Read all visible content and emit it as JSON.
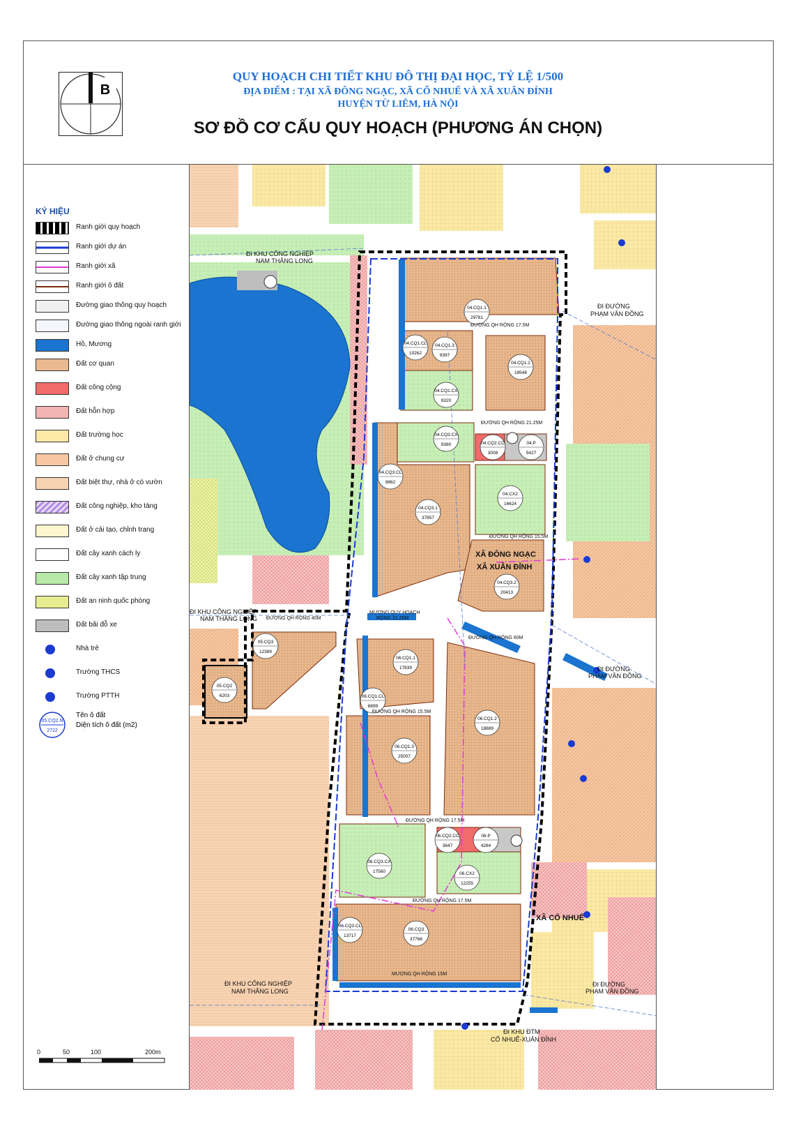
{
  "header": {
    "logo_letter": "B",
    "line1": "QUY HOẠCH CHI TIẾT KHU ĐÔ THỊ ĐẠI HỌC, TỶ LỆ 1/500",
    "line2": "ĐỊA ĐIỂM : TẠI XÃ ĐÔNG NGẠC, XÃ CỔ NHUẾ VÀ XÃ XUÂN ĐỈNH",
    "line3": "HUYỆN TỪ LIÊM, HÀ NỘI",
    "main_title": "SƠ ĐỒ CƠ CẤU QUY HOẠCH (PHƯƠNG ÁN CHỌN)"
  },
  "legend": {
    "title": "KÝ HIỆU",
    "items": [
      {
        "label": "Ranh giới quy hoạch",
        "swatch": "boundary-plan"
      },
      {
        "label": "Ranh giới dự án",
        "swatch": "boundary-project"
      },
      {
        "label": "Ranh giới xã",
        "swatch": "boundary-commune"
      },
      {
        "label": "Ranh giới ô đất",
        "swatch": "boundary-lot"
      },
      {
        "label": "Đường giao thông quy hoạch",
        "swatch": "road-plan"
      },
      {
        "label": "Đường giao thông ngoài ranh giới",
        "swatch": "road-outside"
      },
      {
        "label": "Hồ, Mương",
        "swatch": "water"
      },
      {
        "label": "Đất cơ quan",
        "swatch": "office"
      },
      {
        "label": "Đất công cộng",
        "swatch": "public"
      },
      {
        "label": "Đất hỗn hợp",
        "swatch": "mixed"
      },
      {
        "label": "Đất trường học",
        "swatch": "school"
      },
      {
        "label": "Đất ở chung cư",
        "swatch": "apartment"
      },
      {
        "label": "Đất biệt thự, nhà ở có vườn",
        "swatch": "villa"
      },
      {
        "label": "Đất công nghiệp, kho tàng",
        "swatch": "industry"
      },
      {
        "label": "Đất ở cải tạo, chỉnh trang",
        "swatch": "renovation"
      },
      {
        "label": "Đất cây xanh cách ly",
        "swatch": "green-buffer"
      },
      {
        "label": "Đất cây xanh tập trung",
        "swatch": "green"
      },
      {
        "label": "Đất an ninh quốc phòng",
        "swatch": "defense"
      },
      {
        "label": "Đất bãi đỗ xe",
        "swatch": "parking"
      },
      {
        "label": "Nhà trẻ",
        "swatch": "kindergarten"
      },
      {
        "label": "Trường THCS",
        "swatch": "middle-school"
      },
      {
        "label": "Trường PTTH",
        "swatch": "high-school"
      }
    ],
    "sample_lot": {
      "name": "05.CQ2.N",
      "area": "2722"
    },
    "sample_name_label": "Tên ô đất",
    "sample_area_label": "Diện tích ô đất (m2)"
  },
  "colors": {
    "office": "#e9b98f",
    "public": "#f26b6b",
    "mixed": "#f3b4b4",
    "school": "#fbe9a6",
    "apartment": "#f6c7a2",
    "villa": "#f7d3b3",
    "green": "#b9e9a8",
    "water": "#1a74d0",
    "parking": "#bdbdbd",
    "road": "#ffffff",
    "defense": "#e6ec8f",
    "industry": "#b48ee0",
    "renovation": "#fdf6cf",
    "boundary_project": "#1a3ad1",
    "boundary_commune": "#e03ad4"
  },
  "lots": [
    {
      "name": "04.CQ1.1",
      "area": "29781"
    },
    {
      "name": "04.CQ1.CL",
      "area": "10262"
    },
    {
      "name": "04.CQ1.3",
      "area": "9397"
    },
    {
      "name": "04.CQ1.2",
      "area": "18548"
    },
    {
      "name": "04.CQ1.CX",
      "area": "9320"
    },
    {
      "name": "04.CQ3.CX",
      "area": "9380"
    },
    {
      "name": "04.CQ2.CC",
      "area": "3008"
    },
    {
      "name": "04.P",
      "area": "5427"
    },
    {
      "name": "04.CQ3.CL",
      "area": "9862"
    },
    {
      "name": "04.CX2",
      "area": "16624"
    },
    {
      "name": "04.CQ3.1",
      "area": "37857"
    },
    {
      "name": "04.CQ3.2",
      "area": "20413"
    },
    {
      "name": "05.CQ3",
      "area": "12389"
    },
    {
      "name": "06.CQ1.1",
      "area": "17839"
    },
    {
      "name": "05.CQ2",
      "area": "6203"
    },
    {
      "name": "06.CQ1.CL",
      "area": "8899"
    },
    {
      "name": "06.CQ1.2",
      "area": "18889"
    },
    {
      "name": "06.CQ1.3",
      "area": "25007"
    },
    {
      "name": "06.CQ2.CC",
      "area": "3647"
    },
    {
      "name": "06.P",
      "area": "4284"
    },
    {
      "name": "06.CQ3.CX",
      "area": "17560"
    },
    {
      "name": "06.CX2",
      "area": "12255"
    },
    {
      "name": "06.CQ3.CL",
      "area": "13717"
    },
    {
      "name": "06.CQ3",
      "area": "37766"
    }
  ],
  "map_labels": {
    "to_industrial_1": "ĐI KHU CÔNG NGHIỆP",
    "to_industrial_1b": "NAM THĂNG LONG",
    "to_industrial_2": "ĐI KHU CÔNG NGHIỆP",
    "to_industrial_2b": "NAM THĂNG LONG",
    "to_industrial_3": "ĐI KHU CÔNG NGHIỆP",
    "to_industrial_3b": "NAM THĂNG LONG",
    "to_pvd_1": "ĐI ĐƯỜNG",
    "to_pvd_1b": "PHẠM VĂN ĐỒNG",
    "to_pvd_2": "ĐI ĐƯỜNG",
    "to_pvd_2b": "PHẠM VĂN ĐỒNG",
    "to_pvd_3": "ĐI ĐƯỜNG",
    "to_pvd_3b": "PHẠM VĂN ĐỒNG",
    "to_dtm": "ĐI KHU ĐTM",
    "to_dtm_b": "CỔ NHUẾ-XUÂN ĐỈNH",
    "commune_dong_ngac": "XÃ ĐÔNG NGẠC",
    "commune_xuan_dinh": "XÃ XUÂN ĐỈNH",
    "commune_co_nhue": "XÃ CỔ NHUẾ",
    "road_21_25": "ĐƯỜNG QH RỘNG 21.25M",
    "road_17_5_a": "ĐƯỜNG QH RỘNG 17.5M",
    "road_17_5_b": "ĐƯỜNG QH RỘNG 17.5M",
    "road_17_5_c": "ĐƯỜNG QH RỘNG 17.5M",
    "road_15_5_a": "ĐƯỜNG QH RỘNG 15.5M",
    "road_15_5_b": "ĐƯỜNG QH RỘNG 15.5M",
    "road_40": "ĐƯỜNG QH RỘNG 40M",
    "road_60": "ĐƯỜNG QH RỘNG 60M",
    "canal_21_25": "MƯƠNG QUY HOẠCH",
    "canal_21_25b": "RỘNG 21.25M",
    "canal_15": "MƯƠNG QH RỘNG 15M"
  },
  "scale": {
    "t0": "0",
    "t1": "50",
    "t2": "100",
    "t3": "200m"
  }
}
